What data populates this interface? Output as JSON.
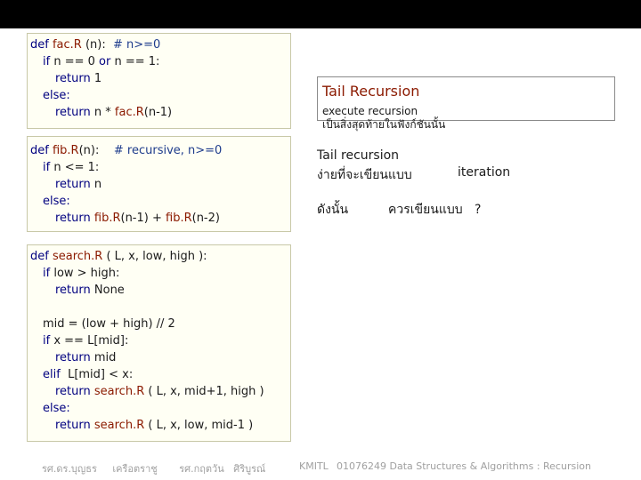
{
  "code_blocks": {
    "fac": {
      "lines": [
        {
          "indent": 0,
          "parts": [
            [
              "kw",
              "def "
            ],
            [
              "fn",
              "fac.R"
            ],
            [
              "n",
              " (n):  "
            ],
            [
              "cm",
              "# n>=0"
            ]
          ]
        },
        {
          "indent": 1,
          "parts": [
            [
              "kw",
              "if "
            ],
            [
              "n",
              "n == 0 "
            ],
            [
              "kw",
              "or "
            ],
            [
              "n",
              "n == 1:"
            ]
          ]
        },
        {
          "indent": 2,
          "parts": [
            [
              "kw",
              "return "
            ],
            [
              "n",
              "1"
            ]
          ]
        },
        {
          "indent": 1,
          "parts": [
            [
              "kw",
              "else:"
            ]
          ]
        },
        {
          "indent": 2,
          "parts": [
            [
              "kw",
              "return "
            ],
            [
              "n",
              "n * "
            ],
            [
              "fn",
              "fac.R"
            ],
            [
              "n",
              "(n-1)"
            ]
          ]
        }
      ]
    },
    "fib": {
      "lines": [
        {
          "indent": 0,
          "parts": [
            [
              "kw",
              "def "
            ],
            [
              "fn",
              "fib.R"
            ],
            [
              "n",
              "(n):    "
            ],
            [
              "cm",
              "# recursive, n>=0"
            ]
          ]
        },
        {
          "indent": 1,
          "parts": [
            [
              "kw",
              "if "
            ],
            [
              "n",
              "n <= 1:"
            ]
          ]
        },
        {
          "indent": 2,
          "parts": [
            [
              "kw",
              "return "
            ],
            [
              "n",
              "n"
            ]
          ]
        },
        {
          "indent": 1,
          "parts": [
            [
              "kw",
              "else:"
            ]
          ]
        },
        {
          "indent": 2,
          "parts": [
            [
              "kw",
              "return "
            ],
            [
              "fn",
              "fib.R"
            ],
            [
              "n",
              "(n-1) + "
            ],
            [
              "fn",
              "fib.R"
            ],
            [
              "n",
              "(n-2)"
            ]
          ]
        }
      ]
    },
    "search": {
      "lines": [
        {
          "indent": 0,
          "parts": [
            [
              "kw",
              "def "
            ],
            [
              "fn",
              "search.R"
            ],
            [
              "n",
              " ( L, x, low, high ):"
            ]
          ]
        },
        {
          "indent": 1,
          "parts": [
            [
              "kw",
              "if "
            ],
            [
              "n",
              "low > high:"
            ]
          ]
        },
        {
          "indent": 2,
          "parts": [
            [
              "kw",
              "return "
            ],
            [
              "n",
              "None"
            ]
          ]
        },
        {
          "indent": 0,
          "parts": [
            [
              "n",
              ""
            ]
          ]
        },
        {
          "indent": 1,
          "parts": [
            [
              "n",
              "mid = (low + high) // 2"
            ]
          ]
        },
        {
          "indent": 1,
          "parts": [
            [
              "kw",
              "if "
            ],
            [
              "n",
              "x == L[mid]:"
            ]
          ]
        },
        {
          "indent": 2,
          "parts": [
            [
              "kw",
              "return "
            ],
            [
              "n",
              "mid"
            ]
          ]
        },
        {
          "indent": 1,
          "parts": [
            [
              "kw",
              "elif "
            ],
            [
              "n",
              " L[mid] < x:"
            ]
          ]
        },
        {
          "indent": 2,
          "parts": [
            [
              "kw",
              "return "
            ],
            [
              "fn",
              "search.R"
            ],
            [
              "n",
              " ( L, x, mid+1, high )"
            ]
          ]
        },
        {
          "indent": 1,
          "parts": [
            [
              "kw",
              "else:"
            ]
          ]
        },
        {
          "indent": 2,
          "parts": [
            [
              "kw",
              "return "
            ],
            [
              "fn",
              "search.R"
            ],
            [
              "n",
              " ( L, x, low, mid-1 )"
            ]
          ]
        }
      ]
    }
  },
  "tail_box": {
    "title": "Tail Recursion",
    "subtitle": "execute recursion",
    "thai_line": "เป็นสิ่งสุดท้ายในฟังก์ชันนั้น"
  },
  "notes": {
    "line1": "Tail recursion",
    "line2a": "ง่ายที่จะเขียนแบบ",
    "line2b": "iteration",
    "line3a": "ดังนั้น",
    "line3b": "ควรเขียนแบบ   ?"
  },
  "footer": {
    "authors": "รศ.ดร.บุญธร     เครือตราชู       รศ.กฤตวัน   ศิริบูรณ์",
    "org": "KMITL",
    "course": "01076249 Data Structures & Algorithms : Recursion"
  },
  "colors": {
    "keyword": "#000080",
    "function": "#8b1a00",
    "comment": "#1e3c8c",
    "code_bg": "#fffff4"
  }
}
